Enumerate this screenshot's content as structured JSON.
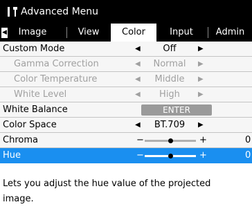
{
  "window": {
    "title": "Advanced Menu",
    "icon": "tools-icon"
  },
  "tabs": [
    {
      "label": "Image"
    },
    {
      "label": "View"
    },
    {
      "label": "Color",
      "active": true
    },
    {
      "label": "Input"
    },
    {
      "label": "Admin"
    }
  ],
  "menu": {
    "custom_mode": {
      "label": "Custom Mode",
      "value": "Off"
    },
    "gamma_correction": {
      "label": "Gamma Correction",
      "value": "Normal"
    },
    "color_temperature": {
      "label": "Color Temperature",
      "value": "Middle"
    },
    "white_level": {
      "label": "White Level",
      "value": "High"
    },
    "white_balance": {
      "label": "White Balance",
      "button": "ENTER"
    },
    "color_space": {
      "label": "Color Space",
      "value": "BT.709"
    },
    "chroma": {
      "label": "Chroma",
      "minus": "−",
      "plus": "+",
      "value": "0",
      "level": 0.5
    },
    "hue": {
      "label": "Hue",
      "minus": "−",
      "plus": "+",
      "value": "0",
      "level": 0.5
    }
  },
  "description": {
    "line1": "Lets you adjust the hue value of the projected",
    "line2": "image."
  },
  "colors": {
    "selection": "#1a8ff0",
    "titlebar": "#000000",
    "disabled_text": "#a0a0a0",
    "enter_button": "#9a9a9a"
  }
}
